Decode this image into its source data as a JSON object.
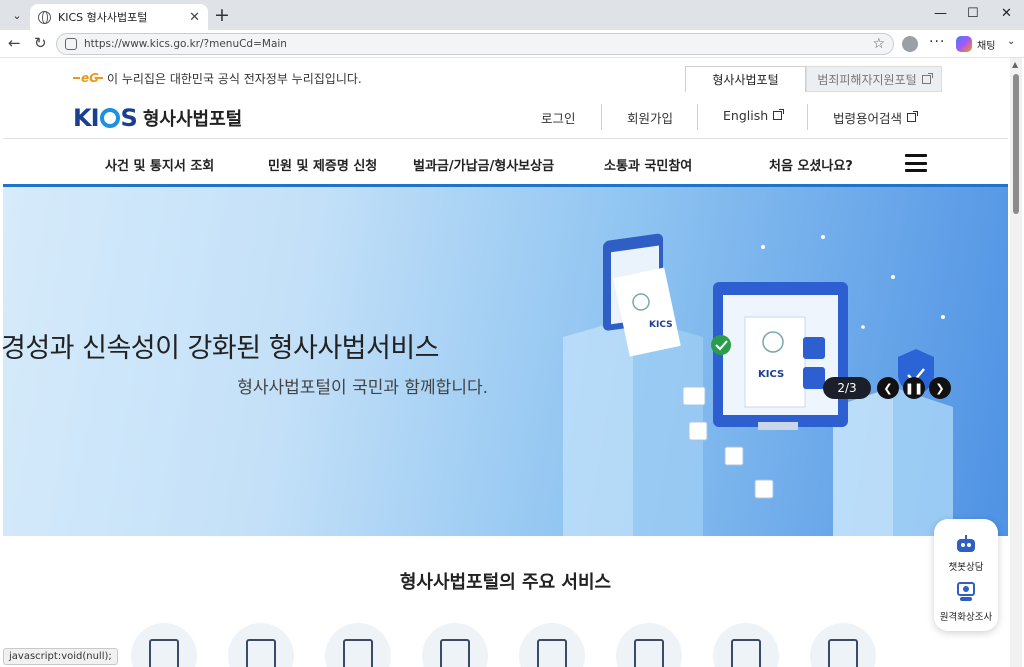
{
  "browser": {
    "tab_title": "KICS 형사사법포털",
    "url": "https://www.kics.go.kr/?menuCd=Main",
    "chat_label": "채팅",
    "status_text": "javascript:void(null);"
  },
  "header": {
    "gov_notice": "이 누리집은 대한민국 공식 전자정부 누리집입니다.",
    "portal_tabs": [
      "형사사법포털",
      "범죄피해자지원포털"
    ],
    "logo_kics": "KICS",
    "logo_name": "형사사법포털",
    "util_links": [
      "로그인",
      "회원가입",
      "English",
      "법령용어검색"
    ]
  },
  "gnb": {
    "items": [
      "사건 및 통지서 조회",
      "민원 및 제증명 신청",
      "벌과금/가납금/형사보상금",
      "소통과 국민참여",
      "처음 오셨나요?"
    ]
  },
  "hero": {
    "title": "경성과 신속성이 강화된 형사사법서비스",
    "subtitle": "형사사법포털이 국민과 함께합니다.",
    "slide_counter": "2/3",
    "illustration_logo": "KICS"
  },
  "services": {
    "title": "형사사법포털의 주요 서비스"
  },
  "floating": {
    "chatbot": "챗봇상담",
    "video": "원격화상조사"
  },
  "colors": {
    "brand_blue": "#1b3f8f",
    "accent_blue": "#1f73c9",
    "gov_orange": "#e89a1a"
  }
}
